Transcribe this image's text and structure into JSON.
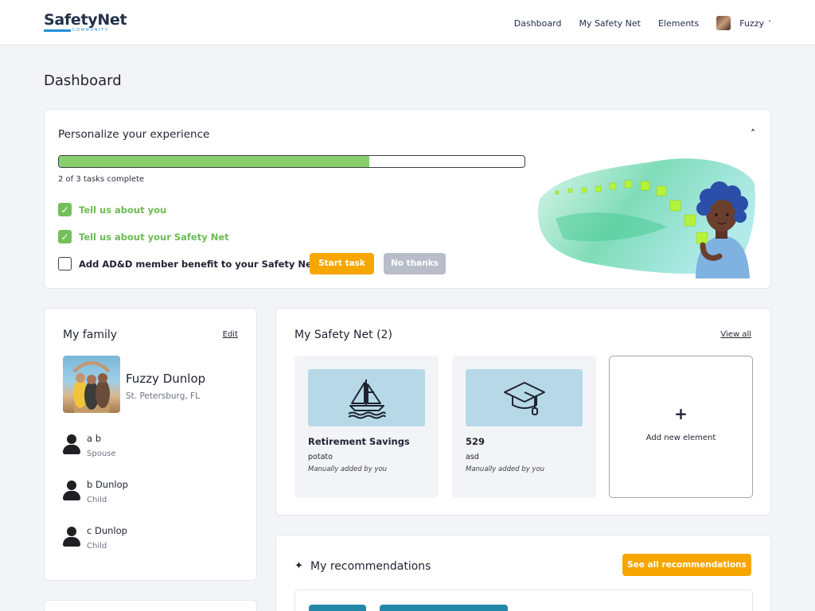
{
  "header": {
    "logo_main": "SafetyNet",
    "logo_sub": "COMMUNITY",
    "nav": [
      "Dashboard",
      "My Safety Net",
      "Elements"
    ],
    "user_name": "Fuzzy",
    "user_chevron": "˅"
  },
  "page_title": "Dashboard",
  "personalize": {
    "title": "Personalize your experience",
    "collapse_icon": "˄",
    "progress_fraction": 0.667,
    "tasks_complete_text": "2 of 3 tasks complete",
    "tasks": [
      {
        "label": "Tell us about you",
        "done": true
      },
      {
        "label": "Tell us about your Safety Net",
        "done": true
      },
      {
        "label": "Add AD&D member benefit to your Safety Net",
        "done": false
      }
    ],
    "start_task": "Start task",
    "no_thanks": "No thanks"
  },
  "family": {
    "title": "My family",
    "edit": "Edit",
    "primary_name": "Fuzzy Dunlop",
    "primary_location": "St. Petersburg, FL",
    "members": [
      {
        "name": "a b",
        "role": "Spouse"
      },
      {
        "name": "b Dunlop",
        "role": "Child"
      },
      {
        "name": "c Dunlop",
        "role": "Child"
      }
    ]
  },
  "safety_net": {
    "title": "My Safety Net (2)",
    "view_all": "View all",
    "elements": [
      {
        "name": "Retirement Savings",
        "desc": "potato",
        "source": "Manually added by you",
        "icon": "sailboat-icon"
      },
      {
        "name": "529",
        "desc": "asd",
        "source": "Manually added by you",
        "icon": "graduation-cap-icon"
      }
    ],
    "add_plus": "+",
    "add_label": "Add new element"
  },
  "recommendations": {
    "title": "My recommendations",
    "sparkle": "✦",
    "see_all": "See all recommendations"
  },
  "colors": {
    "accent_orange": "#f7a600",
    "progress_green": "#86cf6a",
    "done_green": "#6dbb54",
    "tile_blue": "#b7d9e7"
  }
}
